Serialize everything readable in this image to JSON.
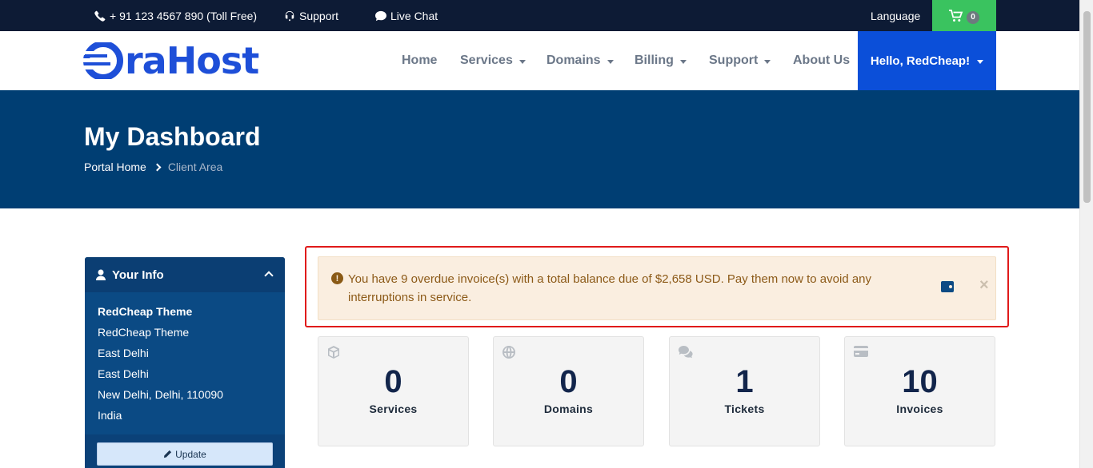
{
  "topbar": {
    "phone": "+ 91 123 4567 890 (Toll Free)",
    "support": "Support",
    "live_chat": "Live Chat",
    "language": "Language",
    "cart_count": "0"
  },
  "brand": {
    "logo_text": "raHost",
    "color": "#1e4fd8"
  },
  "nav": {
    "home": "Home",
    "services": "Services",
    "domains": "Domains",
    "billing": "Billing",
    "support": "Support",
    "about": "About Us",
    "user": "Hello, RedCheap!"
  },
  "hero": {
    "title": "My Dashboard",
    "breadcrumb": [
      "Portal Home",
      "Client Area"
    ]
  },
  "sidebar": {
    "title": "Your Info",
    "name": "RedCheap Theme",
    "lines": [
      "RedCheap Theme",
      "East Delhi",
      "East Delhi",
      "New Delhi, Delhi, 110090",
      "India"
    ],
    "update_label": "Update"
  },
  "alert": {
    "message": "You have 9 overdue invoice(s) with a total balance due of $2,658 USD. Pay them now to avoid any interruptions in service.",
    "close": "×"
  },
  "tiles": [
    {
      "value": "0",
      "label": "Services",
      "icon": "cube-icon"
    },
    {
      "value": "0",
      "label": "Domains",
      "icon": "globe-icon"
    },
    {
      "value": "1",
      "label": "Tickets",
      "icon": "comments-icon"
    },
    {
      "value": "10",
      "label": "Invoices",
      "icon": "credit-card-icon"
    }
  ],
  "colors": {
    "topbar": "#0d1b35",
    "hero": "#003e73",
    "accent": "#0b4fd9",
    "cart": "#3ac35f",
    "alert_border": "#e01a1a"
  }
}
